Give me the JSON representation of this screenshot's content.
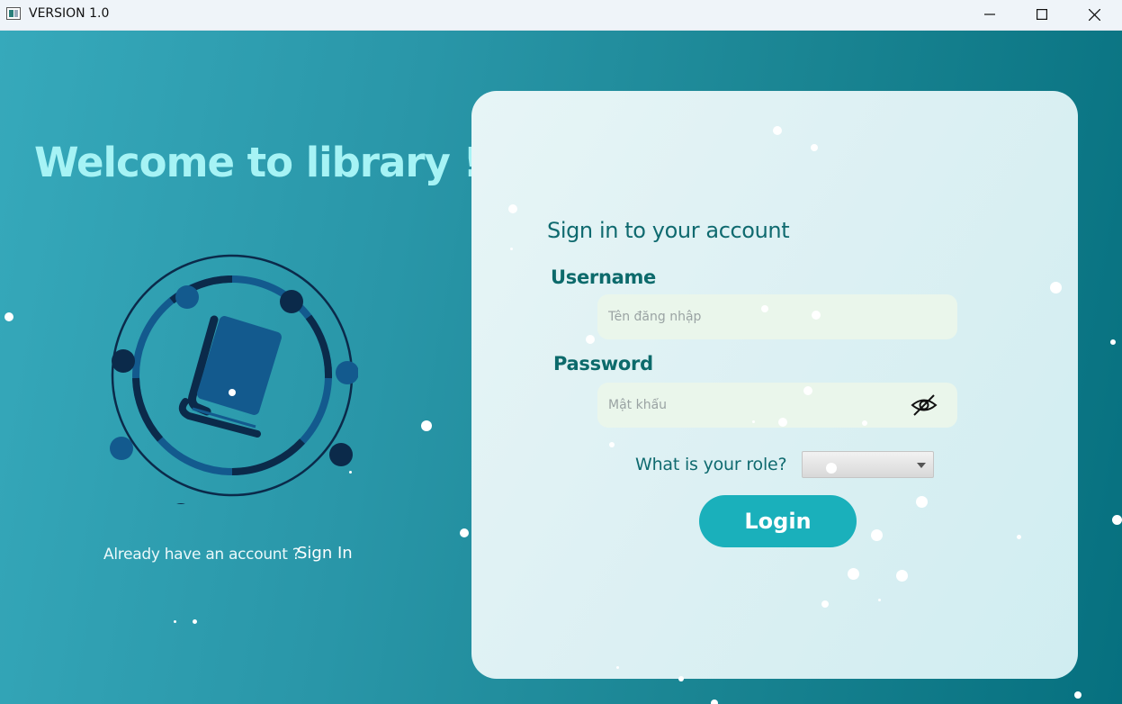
{
  "window": {
    "title": "VERSION 1.0"
  },
  "left": {
    "welcome": "Welcome to library !",
    "already_text": "Already have an account ?",
    "signin_link": "Sign In"
  },
  "card": {
    "title": "Sign in to your account",
    "username_label": "Username",
    "username_placeholder": "Tên đăng nhập",
    "password_label": "Password",
    "password_placeholder": "Mật khẩu",
    "role_label": "What is your role?",
    "role_value": "",
    "login_label": "Login"
  },
  "colors": {
    "accent": "#1ab0bb",
    "heading": "#a6f3f5",
    "text_teal": "#0f6a6f",
    "emblem_blue": "#135a8e",
    "emblem_navy": "#0b2a4a"
  },
  "icons": [
    "app-icon",
    "minimize-icon",
    "maximize-icon",
    "close-icon",
    "book-icon",
    "eye-off-icon",
    "chevron-down-icon"
  ]
}
